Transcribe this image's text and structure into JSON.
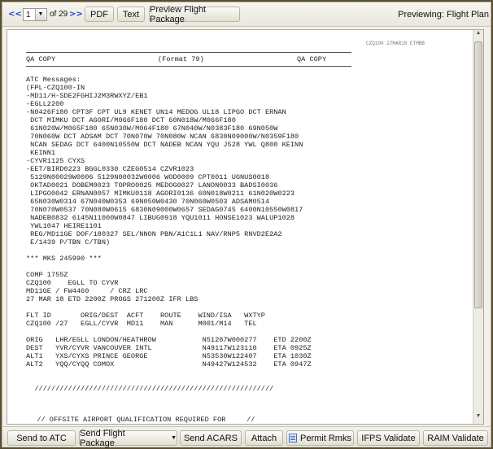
{
  "toolbar": {
    "prev_label": "<<",
    "page_current": "1",
    "page_of": "of 29",
    "next_label": ">>",
    "pdf_label": "PDF",
    "text_label": "Text",
    "preview_label": "Preview Flight Package",
    "previewing_label": "Previewing: Flight Plan"
  },
  "document": {
    "header_small": "CZQ100 27MAR18 ETMBB",
    "copy_left": "QA COPY",
    "format_label": "(Format 79)",
    "copy_right": "QA COPY",
    "body": "ATC Messages:\n(FPL-CZQ100-IN\n-MD11/H-SDE2FGHIJ2M3RWXYZ/EB1\n-EGLL2200\n-N0426F180 CPT3F CPT UL9 KENET UN14 MEDOG UL18 LIPGO DCT ERNAN\n DCT MIMKU DCT AGORI/M066F180 DCT 60N018W/M066F180\n 61N020W/M065F180 65N030W/M064F180 67N040W/N0383F180 69N050W\n 70N060W DCT ADSAM DCT 70N070W 70N080W NCAN 6830N09000W/N0359F180\n NCAN SEDAG DCT 6400N10550W DCT NADEB NCAN YQU J528 YWL Q800 KEINN\n KEINN1\n-CYVR1125 CYXS\n-EET/BIRD0223 BGGL0330 CZEG0514 CZVR1023\n 5129N00029W0006 5129N00032W0006 WOD0009 CPT0011 UGNUS0018\n OKTAD0021 DOBEM0023 TOPRO0025 MEDOG0027 LANON0033 BADSI0036\n LIPGO0042 ERNAN0057 MIMKU0118 AGORI0136 60N018W0211 61N020W0223\n 65N030W0314 67N040W0353 69N050W0430 70N060W0503 ADSAM0514\n 70N070W0537 70N080W0615 6830N09000W0657 SEDAG0745 6400N10550W0817\n NADEB0832 6145N11000W0847 LIBUG0918 YQU1011 HONSE1023 WALUP1028\n YWL1047 HEIRE1101\n REG/MD11GE DOF/180327 SEL/NNON PBN/A1C1L1 NAV/RNP5 RNVD2E2A2\n E/1439 P/TBN C/TBN)\n\n*** MKS 245990 ***\n\nCOMP 1755Z\nCZQ100    EGLL TO CYVR\nMD11GE / FW4460     / CRZ LRC\n27 MAR 18 ETD 2200Z PROGS 271200Z IFR LBS\n\nFLT ID       ORIG/DEST  ACFT    ROUTE    WIND/ISA   WXTYP\nCZQ100 /27   EGLL/CYVR  MD11    MAN      M001/M14   TEL\n\nORIG   LHR/EGLL LONDON/HEATHROW           N51287W000277    ETD 2200Z\nDEST   YVR/CYVR VANCOUVER INTL            N49117W123110    ETA 0925Z\nALT1   YXS/CYXS PRINCE GEORGE             N53530W122407    ETA 1030Z\nALT2   YQQ/CYQQ COMOX                     N49427W124532    ETA 0947Z\n\n\n  /////////////////////////////////////////////////////////",
    "tail": "  // OFFSITE AIRPORT QUALIFICATION REQUIRED FOR     //"
  },
  "bottombar": {
    "send_atc": "Send to ATC",
    "send_flight_package": "Send Flight Package",
    "send_acars": "Send ACARS",
    "attach": "Attach",
    "permit_rmks": "Permit Rmks",
    "ifps_validate": "IFPS Validate",
    "raim_validate": "RAIM Validate"
  },
  "icons": {
    "dropdown": "chevron-down-icon",
    "scroll_up": "scroll-up-arrow-icon",
    "scroll_down": "scroll-down-arrow-icon",
    "permit": "document-icon"
  }
}
